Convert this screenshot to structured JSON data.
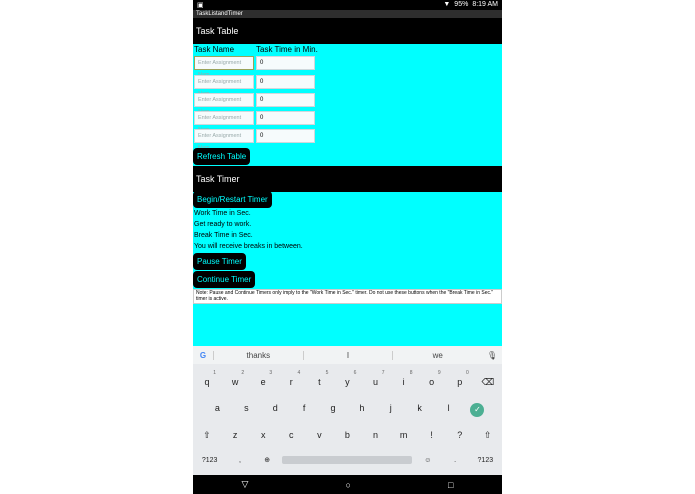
{
  "statusbar": {
    "time": "8:19 AM",
    "battery": "95%"
  },
  "appbar_title": "TaskListandTimer",
  "task_table": {
    "header": "Task Table",
    "col1": "Task Name",
    "col2": "Task Time in Min.",
    "rows": [
      {
        "placeholder": "Enter Assignment Nam",
        "time": "0"
      },
      {
        "placeholder": "Enter Assignment Nam",
        "time": "0"
      },
      {
        "placeholder": "Enter Assignment Nam",
        "time": "0"
      },
      {
        "placeholder": "Enter Assignment Nam",
        "time": "0"
      },
      {
        "placeholder": "Enter Assignment Nam",
        "time": "0"
      }
    ],
    "refresh": "Refresh Table"
  },
  "task_timer": {
    "header": "Task Timer",
    "begin": "Begin/Restart Timer",
    "lines": [
      "Work Time in Sec.",
      "Get ready to work.",
      "Break Time in Sec.",
      "You will receive breaks in between."
    ],
    "pause": "Pause Timer",
    "continue": "Continue Timer",
    "note": "Note: Pause and Continue Timers only imply to the \"Work Time in Sec.\" timer. Do not use these buttons when the \"Break Time in Sec.\" timer is active."
  },
  "keyboard": {
    "suggestions": [
      "thanks",
      "I",
      "we"
    ],
    "row1": [
      "q",
      "w",
      "e",
      "r",
      "t",
      "y",
      "u",
      "i",
      "o",
      "p"
    ],
    "row1_nums": [
      "1",
      "2",
      "3",
      "4",
      "5",
      "6",
      "7",
      "8",
      "9",
      "0"
    ],
    "row2": [
      "a",
      "s",
      "d",
      "f",
      "g",
      "h",
      "j",
      "k",
      "l"
    ],
    "row3": [
      "z",
      "x",
      "c",
      "v",
      "b",
      "n",
      "m",
      "!",
      "?"
    ],
    "sym": "?123",
    "comma": ",",
    "period": "."
  }
}
